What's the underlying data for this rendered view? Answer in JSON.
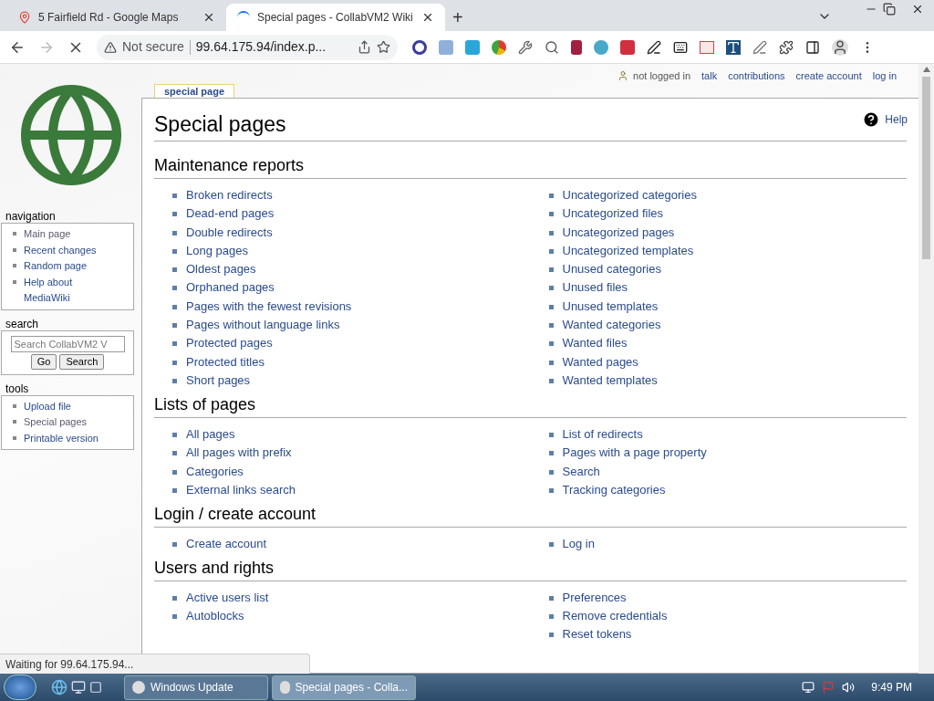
{
  "browser_tabs": [
    {
      "title": "5 Fairfield Rd - Google Maps",
      "selected": false
    },
    {
      "title": "Special pages - CollabVM2 Wiki",
      "selected": true
    }
  ],
  "new_tab": "+",
  "address_bar": {
    "security": "Not secure",
    "url": "99.64.175.94/index.p..."
  },
  "personal_tools": [
    "not logged in",
    "talk",
    "contributions",
    "create account",
    "log in"
  ],
  "sidebar": [
    {
      "title": "navigation",
      "kind": "links",
      "items": [
        {
          "label": "Main page",
          "visited": true
        },
        {
          "label": "Recent changes",
          "visited": false
        },
        {
          "label": "Random page",
          "visited": false
        },
        {
          "label": "Help about MediaWiki",
          "visited": false
        }
      ]
    },
    {
      "title": "search",
      "kind": "search",
      "placeholder": "Search CollabVM2 V",
      "buttons": [
        "Go",
        "Search"
      ]
    },
    {
      "title": "tools",
      "kind": "links",
      "items": [
        {
          "label": "Upload file",
          "visited": false
        },
        {
          "label": "Special pages",
          "visited": true
        },
        {
          "label": "Printable version",
          "visited": false
        }
      ]
    }
  ],
  "content_tab": "special page",
  "page_title": "Special pages",
  "help": "Help",
  "sections": [
    {
      "title": "Maintenance reports",
      "left": [
        "Broken redirects",
        "Dead-end pages",
        "Double redirects",
        "Long pages",
        "Oldest pages",
        "Orphaned pages",
        "Pages with the fewest revisions",
        "Pages without language links",
        "Protected pages",
        "Protected titles",
        "Short pages"
      ],
      "right": [
        "Uncategorized categories",
        "Uncategorized files",
        "Uncategorized pages",
        "Uncategorized templates",
        "Unused categories",
        "Unused files",
        "Unused templates",
        "Wanted categories",
        "Wanted files",
        "Wanted pages",
        "Wanted templates"
      ]
    },
    {
      "title": "Lists of pages",
      "left": [
        "All pages",
        "All pages with prefix",
        "Categories",
        "External links search"
      ],
      "right": [
        "List of redirects",
        "Pages with a page property",
        "Search",
        "Tracking categories"
      ]
    },
    {
      "title": "Login / create account",
      "left": [
        "Create account"
      ],
      "right": [
        "Log in"
      ]
    },
    {
      "title": "Users and rights",
      "left": [
        "Active users list",
        "Autoblocks"
      ],
      "right": [
        "Preferences",
        "Remove credentials",
        "Reset tokens"
      ]
    }
  ],
  "status_bubble": "Waiting for 99.64.175.94...",
  "taskbar": {
    "windows": [
      {
        "title": "Windows Update",
        "selected": false
      },
      {
        "title": "Special pages - Colla...",
        "selected": true
      }
    ],
    "clock": "9:49 PM"
  }
}
